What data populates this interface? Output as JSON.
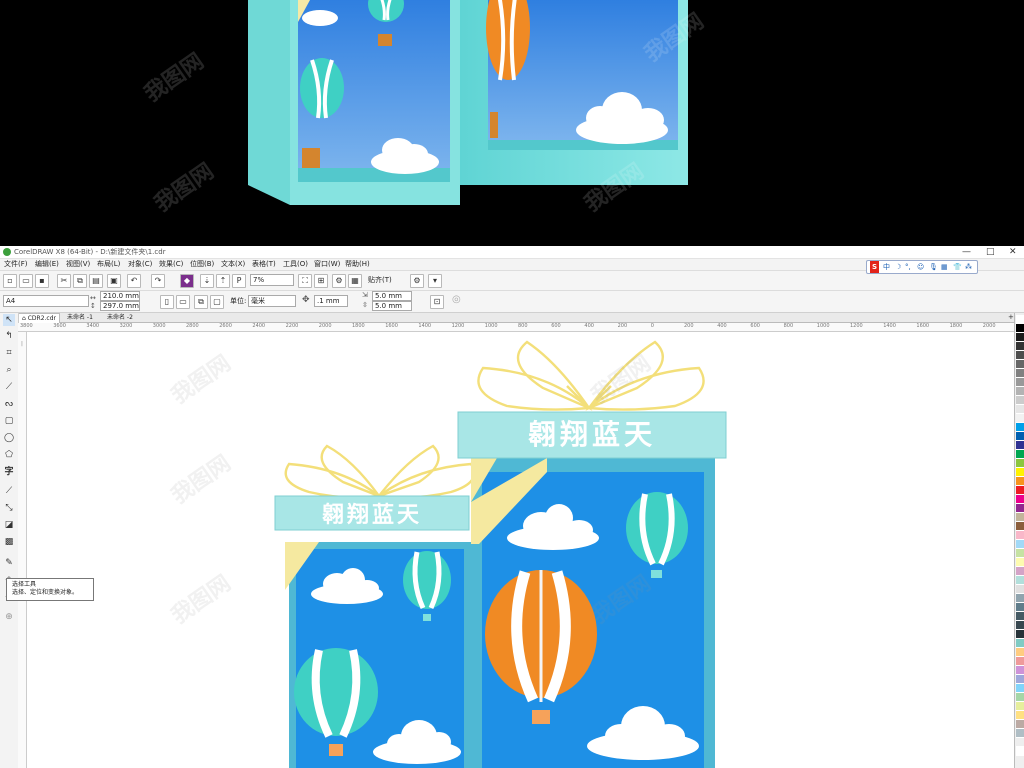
{
  "app": {
    "title": "CorelDRAW X8 (64-Bit) - D:\\新建文件夹\\1.cdr",
    "window_controls": [
      "—",
      "□",
      "✕"
    ],
    "menus": [
      "文件(F)",
      "编辑(E)",
      "视图(V)",
      "布局(L)",
      "对象(C)",
      "效果(C)",
      "位图(B)",
      "文本(X)",
      "表格(T)",
      "工具(O)",
      "窗口(W)",
      "帮助(H)"
    ]
  },
  "toolbar": {
    "zoom": "7%",
    "snap_label": "贴齐(T)"
  },
  "property_bar": {
    "page_size": "A4",
    "width": "210.0 mm",
    "height": "297.0 mm",
    "units_label": "单位:",
    "units": "毫米",
    "nudge": ".1 mm",
    "dup_x": "5.0 mm",
    "dup_y": "5.0 mm"
  },
  "tabs": [
    "CDR2.cdr",
    "未命名 -1",
    "未命名 -2"
  ],
  "ruler": {
    "h_ticks": [
      "3800",
      "3600",
      "3400",
      "3200",
      "3000",
      "2800",
      "2600",
      "2400",
      "2200",
      "2000",
      "1800",
      "1600",
      "1400",
      "1200",
      "1000",
      "800",
      "600",
      "400",
      "200",
      "0",
      "200",
      "400",
      "600",
      "800",
      "1000",
      "1200",
      "1400",
      "1600",
      "1800",
      "2000"
    ]
  },
  "tooltip": {
    "title": "选择工具",
    "desc": "选择、定位和变换对象。"
  },
  "ime": {
    "brand": "S",
    "lang": "中"
  },
  "design": {
    "small_box_text": "翱翔蓝天",
    "large_box_text": "翱翔蓝天"
  },
  "watermark": "我图网",
  "colors": {
    "accent_teal": "#a8e6e6",
    "sky_blue": "#1e90e6",
    "frame_blue": "#4fb8d4",
    "ribbon_yellow": "#f5e9a0",
    "balloon_orange": "#f08a24",
    "balloon_teal": "#3fd0c4"
  },
  "palette": [
    "#ffffff",
    "#000000",
    "#1a1a1a",
    "#333333",
    "#4d4d4d",
    "#666666",
    "#808080",
    "#999999",
    "#b3b3b3",
    "#cccccc",
    "#e6e6e6",
    "#f2f2f2",
    "#00a0e9",
    "#0060b0",
    "#2e3192",
    "#00a651",
    "#8cc63f",
    "#fff200",
    "#f7941d",
    "#ed1c24",
    "#ec008c",
    "#92278f",
    "#c2b59b",
    "#8b5e3c",
    "#f9b7c9",
    "#a2d9f7",
    "#c6e2a3",
    "#fdfbb0",
    "#d4a3c7",
    "#b2dfdb",
    "#e0e0e0",
    "#90a4ae",
    "#607d8b",
    "#455a64",
    "#37474f",
    "#263238",
    "#80cbc4",
    "#ffcc80",
    "#ef9a9a",
    "#ce93d8",
    "#9fa8da",
    "#81d4fa",
    "#a5d6a7",
    "#e6ee9c",
    "#ffe082",
    "#bcaaa4",
    "#b0bec5",
    "#eeeeee",
    "#ffffff"
  ]
}
